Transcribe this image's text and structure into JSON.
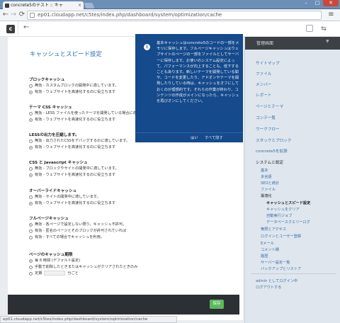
{
  "browser": {
    "tab_title": "concrete5のテスト :: キャ",
    "tab_close": "×",
    "url": "ep01.cloudapp.net/c5tes/index.php/dashboard/system/optimization/cache",
    "win_min": "–",
    "win_max": "□",
    "win_close": "✕",
    "back": "←",
    "forward": "→",
    "reload": "⟳",
    "star": "☆",
    "menu": "≡"
  },
  "c5bar": {
    "logo": "c",
    "back": "←",
    "settings": "⇆"
  },
  "page": {
    "title": "キャッシュとスピード設定",
    "sections": [
      {
        "label": "ブロックキャッシュ",
        "options": [
          {
            "text": "無効 - カスタムブロックの開発中に適しています。",
            "checked": false
          },
          {
            "text": "有効 - ウェブサイトを高速化するのに役立ちます",
            "checked": true
          }
        ]
      },
      {
        "label": "テーマ CSS キャッシュ",
        "options": [
          {
            "text": "無効 - LESS ファイルを使ったテーマを開発している場合に適しています。",
            "checked": false
          },
          {
            "text": "有効 - ウェブサイトを高速化するのに役立ちます",
            "checked": true
          }
        ]
      },
      {
        "label": "LESSの出力を圧縮します。",
        "options": [
          {
            "text": "無効 - 出力されたCSSをデバッグするのに適しています。",
            "checked": false
          },
          {
            "text": "有効 - ウェブサイトを高速化するのに役立ちます",
            "checked": true
          }
        ]
      },
      {
        "label": "CSS と Javascript キャッシュ",
        "options": [
          {
            "text": "無効 - ブロックやサイトの開発中に適しています。",
            "checked": false
          },
          {
            "text": "有効 - ウェブサイトを高速化するのに役立ちます",
            "checked": true
          }
        ]
      },
      {
        "label": "オーバーライドキャッシュ",
        "options": [
          {
            "text": "無効 - サイトの開発中に適しています。",
            "checked": false
          },
          {
            "text": "有効 - ウェブサイトを高速化するのに役立ちます",
            "checked": true
          }
        ]
      },
      {
        "label": "フルページキャッシュ",
        "options": [
          {
            "text": "無効 - 各ページで設定しない限り、キャッシュ不許可。",
            "checked": true
          },
          {
            "text": "有効 - 匿名のページとそのブロックが許可されていれば",
            "checked": false
          },
          {
            "text": "有効 - すべての場合でキャッシュを利用。",
            "checked": false
          }
        ]
      },
      {
        "label": "ページのキャッシュ期限",
        "options": [
          {
            "text": "毎 6 時間 (デフォルト設定)",
            "checked": true
          },
          {
            "text": "手動で削除したときまたはキャッシュがクリアされたときのみ",
            "checked": false
          },
          {
            "text_before": "定期",
            "text_after": "分ごと",
            "checked": false
          }
        ]
      }
    ],
    "help": {
      "info": "i",
      "text": "基本キャッシュはconcrete5のコードの一部をメモリに保存します。フルページキャッシュはウェブサイトのページの一部をファイルとしてサーバーに保存します。お使いのシステム設定によって、パフォーマンスが向上することも、低下することもあります。新しいテーマを開発している間や、コードを変更したり、アドオンやテーマを開発したりしている時は、キャッシュをオフにしておくのが理想的です。それらの作業が終わり、コンテンツの作成がメインになったら、キャッシュを再びオンにしてください。",
      "ok": "はい",
      "hide": "すべて隠す"
    },
    "save": "保存",
    "status": "ep01.cloudapp.net/c5tes/index.php/dashboard/system/optimization/cache"
  },
  "sidebar": {
    "title": "管理画面",
    "items": [
      "サイトマップ",
      "ファイル",
      "メンバー",
      "レポート",
      "ページとテーマ",
      "コンテ一覧",
      "ワークフロー",
      "スタックとブロック",
      "concrete5を拡張"
    ],
    "system": "システムと設定",
    "system_items": [
      "基本",
      "多言語",
      "SEOと統計",
      "ファイル",
      "最適化"
    ],
    "opt_items": [
      "キャッシュとスピード設定",
      "キャッシュをクリア",
      "自動実行ジョブ",
      "データベースクエリーログ"
    ],
    "more_items": [
      "権限とアクセス",
      "ログインとユーザー登録",
      "Eメール",
      "コメント欄",
      "履歴",
      "サーバー設定一覧",
      "バックアップとリストア"
    ],
    "user": "admin としてログイン中",
    "logout": "ログアウトする"
  }
}
